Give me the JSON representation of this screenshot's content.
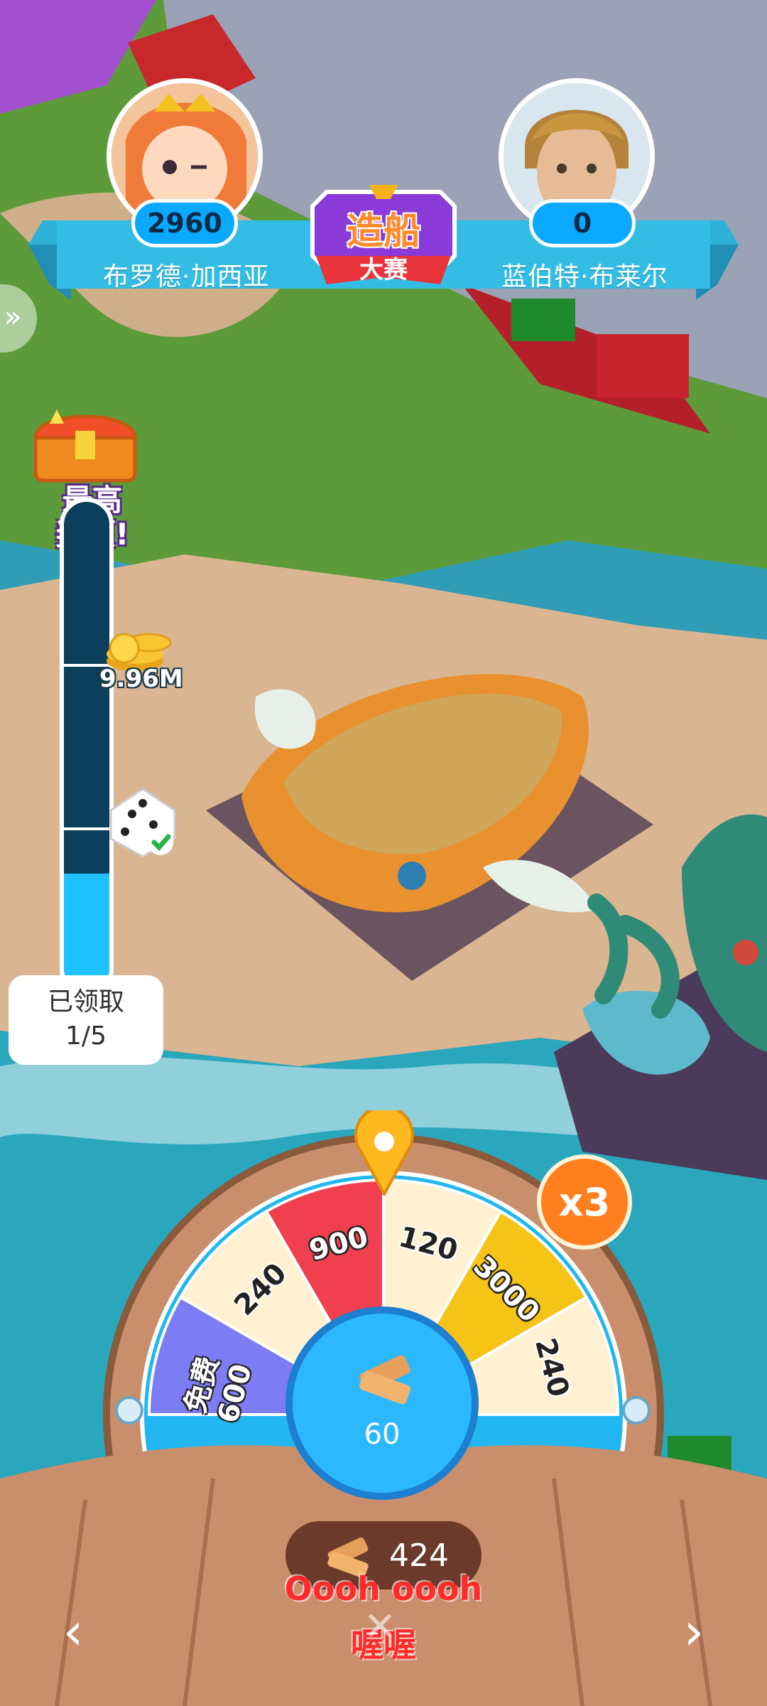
{
  "header": {
    "player_left": {
      "name": "布罗德·加西亚",
      "score": "2960"
    },
    "player_right": {
      "name": "蓝伯特·布莱尔",
      "score": "0"
    },
    "event": {
      "title": "造船",
      "subtitle": "大赛"
    }
  },
  "progress": {
    "top_reward_label": "最高\n奖项!",
    "coins_reward": "9.96M",
    "claimed_label": "已领取",
    "claimed_count": "1/5",
    "fill_fraction": 0.24
  },
  "wheel": {
    "multiplier": "x3",
    "segments": [
      {
        "label": "900",
        "color": "#f0404f"
      },
      {
        "label": "120",
        "color": "#fff1d2"
      },
      {
        "label": "3000",
        "color": "#f6c317"
      },
      {
        "label": "240",
        "color": "#fff1d2"
      },
      {
        "label": "240",
        "color": "#fff1d2"
      },
      {
        "label": "免费 600",
        "color": "#7c7cf5"
      }
    ],
    "hub_value": "60",
    "resource_count": "424"
  },
  "captions": {
    "line1": "Oooh oooh",
    "line2": "喔喔"
  },
  "colors": {
    "banner": "#2eb2d9",
    "accent": "#ff7f1f",
    "wood": "#c98e6c"
  }
}
